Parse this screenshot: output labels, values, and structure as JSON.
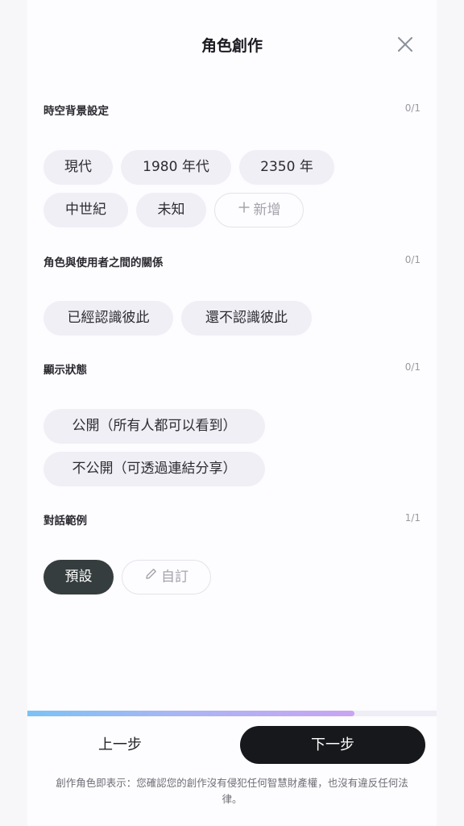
{
  "header": {
    "title": "角色創作",
    "close_icon": "close-icon"
  },
  "sections": [
    {
      "title": "時空背景設定",
      "count": "0/1",
      "chips": [
        {
          "label": "現代"
        },
        {
          "label": "1980 年代"
        },
        {
          "label": "2350 年"
        },
        {
          "label": "中世紀"
        },
        {
          "label": "未知"
        },
        {
          "label": "新增",
          "icon": "plus-icon"
        }
      ]
    },
    {
      "title": "角色與使用者之間的關係",
      "count": "0/1",
      "chips": [
        {
          "label": "已經認識彼此"
        },
        {
          "label": "還不認識彼此"
        }
      ]
    },
    {
      "title": "顯示狀態",
      "count": "0/1",
      "chips": [
        {
          "label": "公開（所有人都可以看到）"
        },
        {
          "label": "不公開（可透過連結分享）"
        }
      ]
    },
    {
      "title": "對話範例",
      "count": "1/1",
      "chips": [
        {
          "label": "預設",
          "selected": true
        },
        {
          "label": "自訂",
          "icon": "pencil-icon"
        }
      ]
    }
  ],
  "progress": {
    "fraction": 0.8
  },
  "footer": {
    "prev_label": "上一步",
    "next_label": "下一步",
    "disclaimer": "創作角色即表示：您確認您的創作沒有侵犯任何智慧財產權，也沒有違反任何法律。"
  },
  "colors": {
    "selected_chip": "#363d3e",
    "chip_bg": "#f0eff6",
    "next_button": "#17181c",
    "progress_start": "#7cc2f5",
    "progress_end": "#c9a4f2"
  }
}
